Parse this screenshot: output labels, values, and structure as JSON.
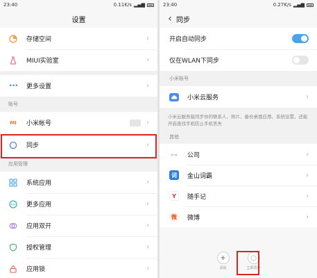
{
  "left": {
    "status": {
      "time": "23:40",
      "net": "0.11K/s"
    },
    "title": "设置",
    "items_top": [
      {
        "name": "storage",
        "label": "存储空间",
        "icon": "pie-icon",
        "color": "#f1a14a"
      },
      {
        "name": "miui-lab",
        "label": "MIUI实验室",
        "icon": "flask-icon",
        "color": "#f06a8a"
      }
    ],
    "more_settings": {
      "label": "更多设置",
      "icon": "dots-icon",
      "color": "#4a8ce8"
    },
    "section_account": "账号",
    "mi_account": {
      "label": "小米帐号",
      "icon": "mi-logo-icon",
      "glyph": "MI",
      "color": "#f2772a"
    },
    "sync": {
      "label": "同步",
      "icon": "sync-circle-icon",
      "color": "#4a8ce8"
    },
    "section_apps": "应用管理",
    "apps": [
      {
        "name": "system-apps",
        "label": "系统应用",
        "icon": "grid-icon",
        "color": "#4aa7e8"
      },
      {
        "name": "more-apps",
        "label": "更多应用",
        "icon": "more-circle-icon",
        "color": "#2ab4c0"
      },
      {
        "name": "dual-apps",
        "label": "应用双开",
        "icon": "dual-icon",
        "color": "#a57be8"
      },
      {
        "name": "permissions",
        "label": "授权管理",
        "icon": "shield-icon",
        "color": "#3ab06f"
      },
      {
        "name": "app-lock",
        "label": "应用锁",
        "icon": "lock-icon",
        "color": "#e25c5c"
      }
    ]
  },
  "right": {
    "status": {
      "time": "23:40",
      "net": "0.27K/s"
    },
    "title": "同步",
    "auto_sync": {
      "label": "开启自动同步",
      "on": true
    },
    "wlan_only": {
      "label": "仅在WLAN下同步",
      "on": false
    },
    "section_mi": "小米账号",
    "cloud": {
      "label": "小米云服务",
      "icon": "cloud-icon",
      "color": "#4a8ce8"
    },
    "note": "小米云服务能同步你的联系人、照片、备份桌面应用、系统设置，还能开启查找手机防止手机丢失",
    "section_other": "其他",
    "accounts": [
      {
        "name": "company",
        "label": "公司",
        "icon": "exchange-icon",
        "glyph": "▸◂",
        "color": "#cfcfcf"
      },
      {
        "name": "kingsoft",
        "label": "金山词霸",
        "icon": "kingsoft-icon",
        "glyph": "词",
        "color": "#2d7fd8"
      },
      {
        "name": "youdao-note",
        "label": "随手记",
        "icon": "note-icon",
        "glyph": "Y",
        "color": "#e33"
      },
      {
        "name": "weibo",
        "label": "微博",
        "icon": "weibo-icon",
        "glyph": "微",
        "color": "#e8502c"
      }
    ],
    "bottom": {
      "add": {
        "label": "添加",
        "icon": "plus-icon",
        "glyph": "+"
      },
      "sync_now": {
        "label": "立即同步",
        "icon": "refresh-icon",
        "glyph": "◌"
      }
    }
  }
}
